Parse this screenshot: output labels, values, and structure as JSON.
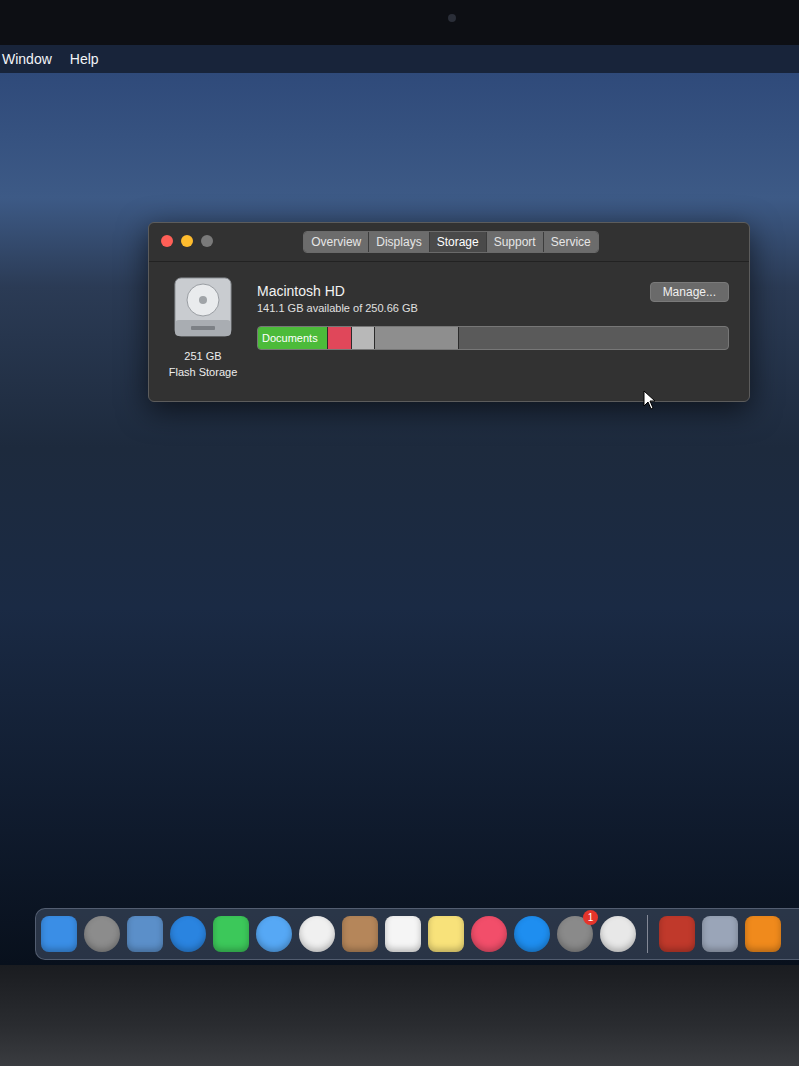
{
  "menu_bar": {
    "items": [
      "Window",
      "Help"
    ]
  },
  "window": {
    "tabs": [
      {
        "label": "Overview",
        "selected": false
      },
      {
        "label": "Displays",
        "selected": false
      },
      {
        "label": "Storage",
        "selected": true
      },
      {
        "label": "Support",
        "selected": false
      },
      {
        "label": "Service",
        "selected": false
      }
    ],
    "disk": {
      "name": "Macintosh HD",
      "available": "141.1 GB available of 250.66 GB",
      "capacity": "251 GB",
      "type": "Flash Storage",
      "button": "Manage..."
    },
    "storage_bar": [
      {
        "label": "Documents",
        "level": 0.148,
        "color": "#4cbb3a"
      },
      {
        "label": "",
        "level": 0.053,
        "color": "#e0475a"
      },
      {
        "label": "",
        "level": 0.047,
        "color": "#b8b8b8"
      },
      {
        "label": "",
        "level": 0.18,
        "color": "#8e8e8e"
      }
    ]
  },
  "dock": {
    "apps": [
      {
        "kind": "square",
        "color": "#3a8ee6",
        "badge": ""
      },
      {
        "kind": "round",
        "color": "#8c8c8c",
        "badge": ""
      },
      {
        "kind": "square",
        "color": "#5b8fc9",
        "badge": ""
      },
      {
        "kind": "round",
        "color": "#2a84e0",
        "badge": ""
      },
      {
        "kind": "square",
        "color": "#3cc85a",
        "badge": ""
      },
      {
        "kind": "round",
        "color": "#56a8f5",
        "badge": ""
      },
      {
        "kind": "round",
        "color": "#f0f0f0",
        "badge": ""
      },
      {
        "kind": "square",
        "color": "#b5865a",
        "badge": ""
      },
      {
        "kind": "square",
        "color": "#f5f5f5",
        "badge": ""
      },
      {
        "kind": "square",
        "color": "#f8e27a",
        "badge": ""
      },
      {
        "kind": "round",
        "color": "#f24e6a",
        "badge": ""
      },
      {
        "kind": "round",
        "color": "#1e8ef0",
        "badge": ""
      },
      {
        "kind": "round",
        "color": "#8a8a8a",
        "badge": "1"
      },
      {
        "kind": "round",
        "color": "#e8e8e8",
        "badge": ""
      }
    ],
    "recent": [
      {
        "kind": "square",
        "color": "#c0392b",
        "badge": ""
      },
      {
        "kind": "square",
        "color": "#9aa5b8",
        "badge": ""
      },
      {
        "kind": "square",
        "color": "#f08a1c",
        "badge": ""
      }
    ]
  }
}
